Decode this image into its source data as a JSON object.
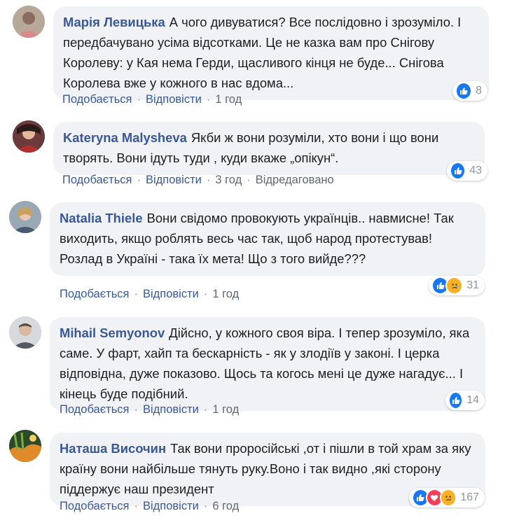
{
  "comments": [
    {
      "author": "Марія Левицька",
      "text": "А чого дивуватися? Все послідовно і зрозуміло. І передбачувано усіма відсотками. Це не казка вам про Снігову Королеву: у Кая нема Герди, щасливого кінця не буде... Снігова Королева вже у кожного в нас вдома...",
      "like_label": "Подобається",
      "reply_label": "Відповісти",
      "time": "1 год",
      "edited": "",
      "reaction_count": "8",
      "reactions": [
        "like-icon"
      ]
    },
    {
      "author": "Kateryna Malysheva",
      "text": "Якби ж вони розуміли, хто вони і що вони творять. Вони ідуть туди , куди вкаже „опікун“.",
      "like_label": "Подобається",
      "reply_label": "Відповісти",
      "time": "3 год",
      "edited": "Відредаговано",
      "reaction_count": "43",
      "reactions": [
        "like-icon"
      ]
    },
    {
      "author": "Natalia Thiele",
      "text": "Вони свідомо провокують українців.. навмисне! Так виходить, якщо роблять весь час так, щоб народ протестував! Розлад в Україні - така їх мета! Що з того вийде???",
      "like_label": "Подобається",
      "reply_label": "Відповісти",
      "time": "1 год",
      "edited": "",
      "reaction_count": "31",
      "reactions": [
        "like-icon",
        "sad-icon"
      ]
    },
    {
      "author": "Mihail Semyonov",
      "text": "Дійсно, у кожного своя віра. І тепер зрозуміло, яка саме. У фарт, хайп та бескарність - як у злодіїв у законі. І церка відповідна, дуже показово. Щось та когось мені це дуже нагадує... І кінець буде подібний.",
      "like_label": "Подобається",
      "reply_label": "Відповісти",
      "time": "1 год",
      "edited": "",
      "reaction_count": "14",
      "reactions": [
        "like-icon"
      ]
    },
    {
      "author": "Наташа Височин",
      "text": "Так вони проросійські ,от і пішли в той храм за яку країну вони найбільше тянуть руку.Воно і так видно ,які сторону піддержує наш президент",
      "like_label": "Подобається",
      "reply_label": "Відповісти",
      "time": "6 год",
      "edited": "",
      "reaction_count": "167",
      "reactions": [
        "like-icon",
        "love-icon",
        "sad-icon"
      ]
    }
  ],
  "colors": {
    "author": "#385898",
    "bubble": "#f0f2f5",
    "like": "#1877f2",
    "love": "#f33e58",
    "sad": "#f7b125"
  }
}
